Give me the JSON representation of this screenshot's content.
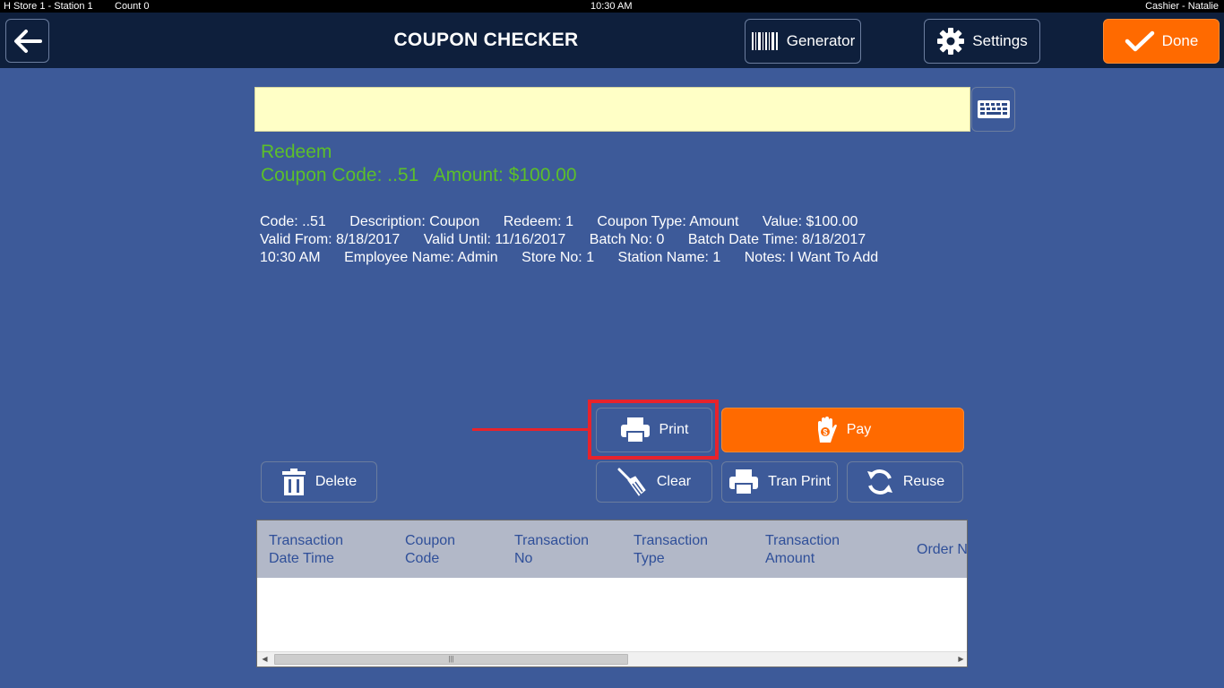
{
  "statusbar": {
    "store_station": "H   Store 1 - Station 1",
    "count": "Count 0",
    "time": "10:30 AM",
    "user": "Cashier - Natalie"
  },
  "header": {
    "title": "COUPON CHECKER",
    "generator_label": "Generator",
    "settings_label": "Settings",
    "done_label": "Done"
  },
  "scan": {
    "value": ""
  },
  "result": {
    "status": "Redeem",
    "code_line": "Coupon Code: ..51   Amount: $100.00"
  },
  "details": {
    "items": [
      "Code: ..51",
      "Description: Coupon",
      "Redeem: 1",
      "Coupon Type: Amount",
      "Value: $100.00",
      "Valid From: 8/18/2017",
      "Valid Until: 11/16/2017",
      "Batch No: 0",
      "Batch Date Time: 8/18/2017",
      "10:30 AM",
      "Employee Name: Admin",
      "Store No: 1",
      "Station Name: 1",
      "Notes: I Want To Add"
    ]
  },
  "actions": {
    "print_label": "Print",
    "pay_label": "Pay",
    "delete_label": "Delete",
    "clear_label": "Clear",
    "tranprint_label": "Tran Print",
    "reuse_label": "Reuse"
  },
  "table": {
    "columns": [
      "Transaction\nDate Time",
      "Coupon\nCode",
      "Transaction\nNo",
      "Transaction\nType",
      "Transaction\nAmount",
      "Order N"
    ],
    "rows": []
  },
  "colors": {
    "background": "#3d5a99",
    "header": "#0e1f3c",
    "accent_orange": "#ff6a00",
    "success_green": "#5cbf2a",
    "annotation_red": "#e8232b"
  }
}
